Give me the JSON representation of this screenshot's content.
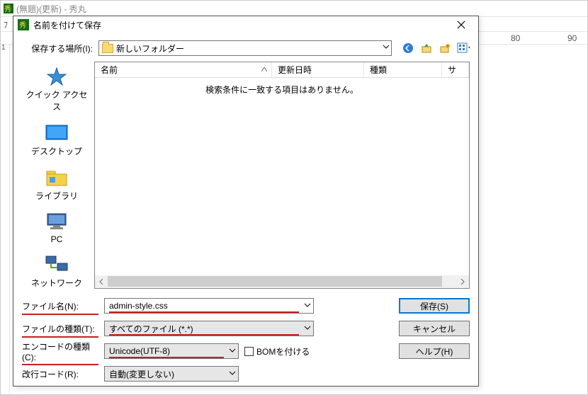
{
  "main": {
    "title": "(無題)(更新) - 秀丸",
    "toolbar_hint": "ﾌ",
    "ruler_ticks": [
      "80",
      "90"
    ],
    "gutter_mark": "1"
  },
  "dialog": {
    "title": "名前を付けて保存",
    "lookin_label": "保存する場所(I):",
    "lookin_value": "新しいフォルダー",
    "places": {
      "quick": "クイック アクセス",
      "desktop": "デスクトップ",
      "library": "ライブラリ",
      "pc": "PC",
      "network": "ネットワーク"
    },
    "columns": {
      "name": "名前",
      "date": "更新日時",
      "type": "種類",
      "size": "サ"
    },
    "empty_msg": "検索条件に一致する項目はありません。",
    "filename_label": "ファイル名(N):",
    "filename_value": "admin-style.css",
    "filetype_label": "ファイルの種類(T):",
    "filetype_value": "すべてのファイル (*.*)",
    "encode_label": "エンコードの種類(C):",
    "encode_value": "Unicode(UTF-8)",
    "newline_label": "改行コード(R):",
    "newline_value": "自動(変更しない)",
    "bom_label": "BOMを付ける",
    "save_btn": "保存(S)",
    "cancel_btn": "キャンセル",
    "help_btn": "ヘルプ(H)"
  }
}
